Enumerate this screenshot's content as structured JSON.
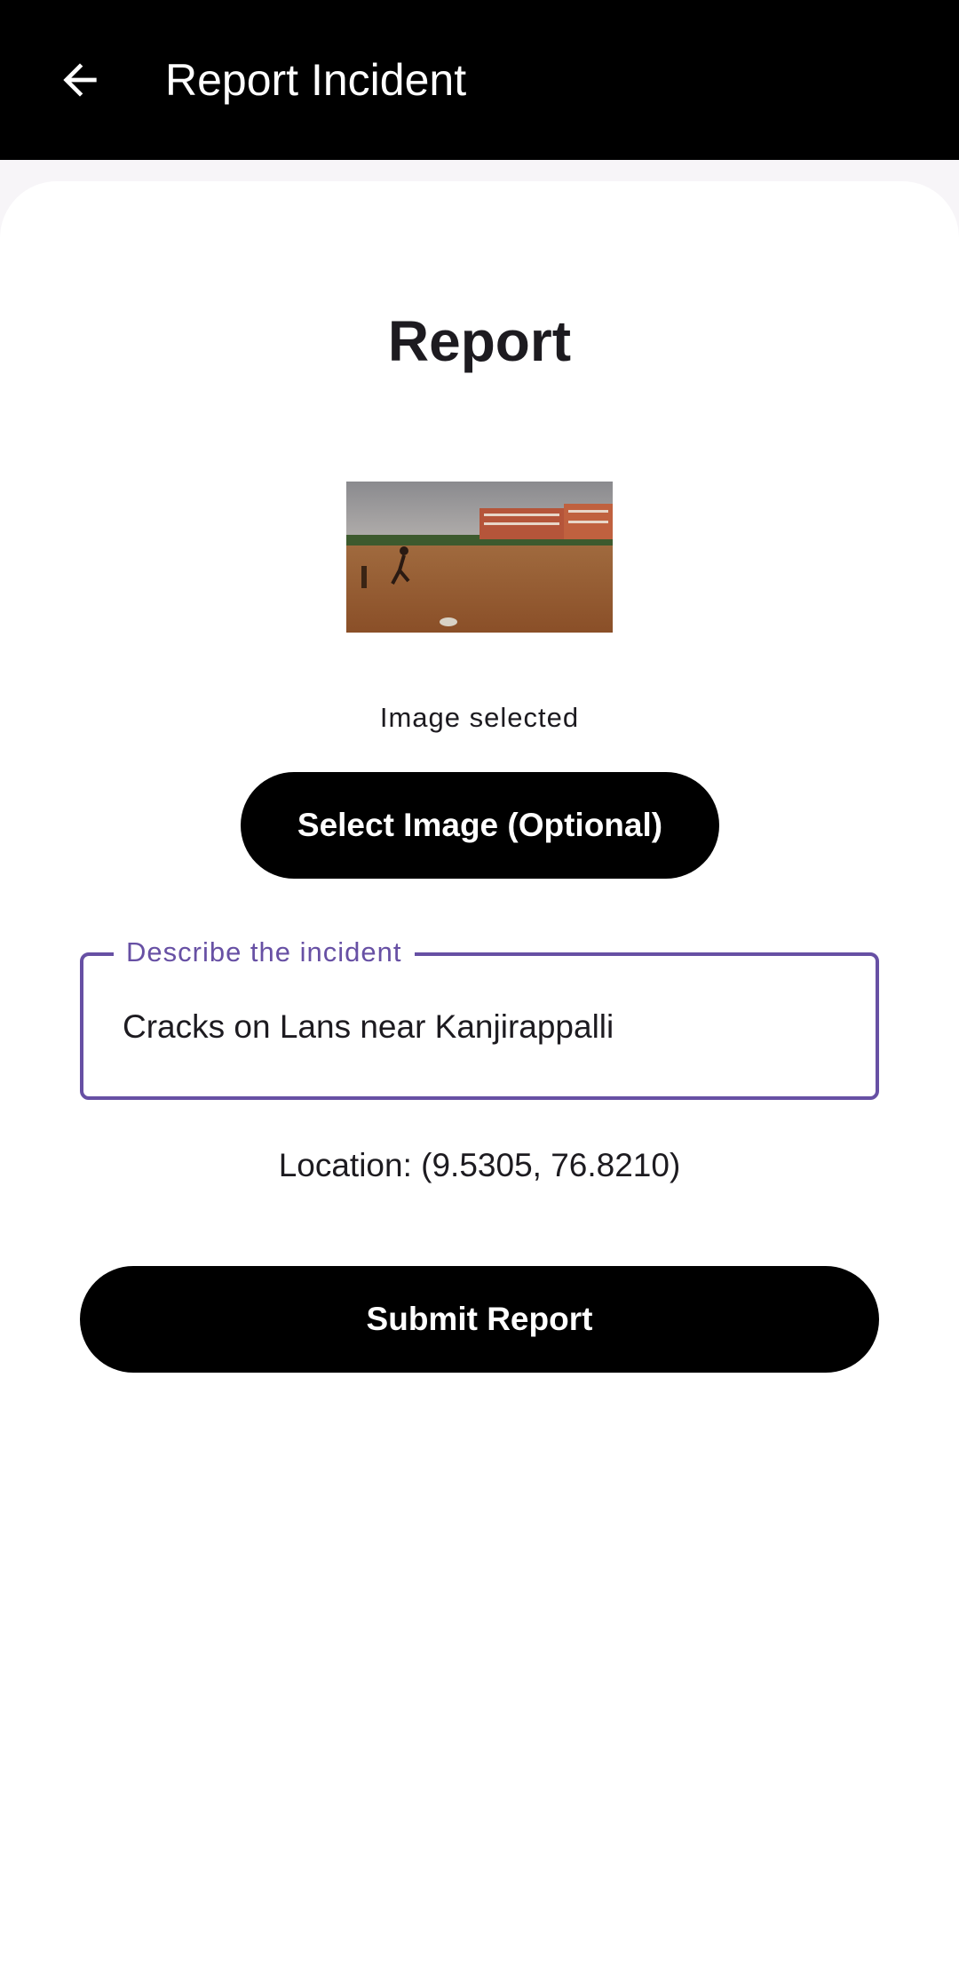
{
  "app_bar": {
    "title": "Report Incident",
    "back_icon": "arrow-left-icon",
    "background": "#000000",
    "text_color": "#ffffff"
  },
  "form": {
    "heading": "Report",
    "image_status": "Image selected",
    "select_image_label": "Select Image (Optional)",
    "description_field": {
      "label": "Describe the incident",
      "value": "Cracks on Lans near Kanjirappalli",
      "accent": "#6750a4"
    },
    "location_text": "Location: (9.5305, 76.8210)",
    "submit_label": "Submit Report"
  }
}
